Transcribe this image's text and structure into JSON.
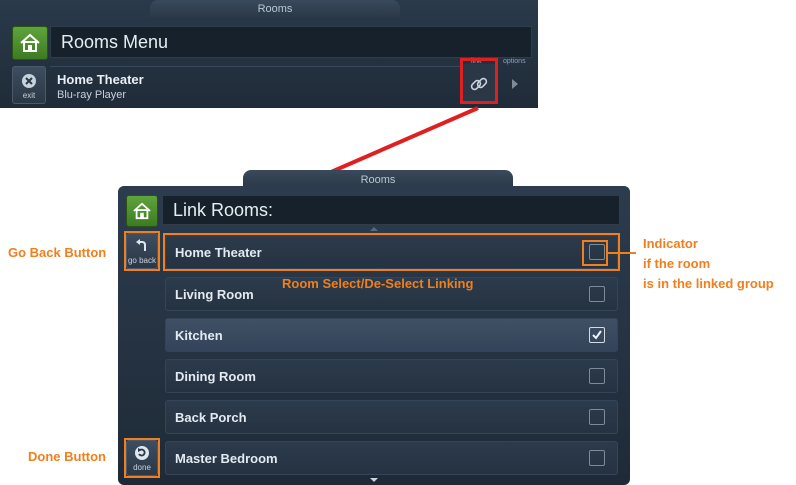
{
  "top_panel": {
    "tab_title": "Rooms",
    "title": "Rooms Menu",
    "exit_label": "exit",
    "room_name": "Home Theater",
    "source_name": "Blu-ray Player",
    "link_label": "link",
    "options_label": "options"
  },
  "main_panel": {
    "tab_title": "Rooms",
    "title": "Link Rooms:",
    "go_back_label": "go back",
    "done_label": "done",
    "rooms": [
      {
        "name": "Home Theater",
        "checked": false
      },
      {
        "name": "Living Room",
        "checked": false
      },
      {
        "name": "Kitchen",
        "checked": true
      },
      {
        "name": "Dining Room",
        "checked": false
      },
      {
        "name": "Back Porch",
        "checked": false
      },
      {
        "name": "Master Bedroom",
        "checked": false
      }
    ]
  },
  "annotations": {
    "go_back": "Go Back Button",
    "done": "Done Button",
    "room_select": "Room Select/De-Select Linking",
    "indicator_line1": "Indicator",
    "indicator_line2": "if the room",
    "indicator_line3": "is in the linked group"
  },
  "colors": {
    "annotation": "#f07f1c",
    "arrow": "#e02020",
    "home_button": "#4e9130"
  }
}
